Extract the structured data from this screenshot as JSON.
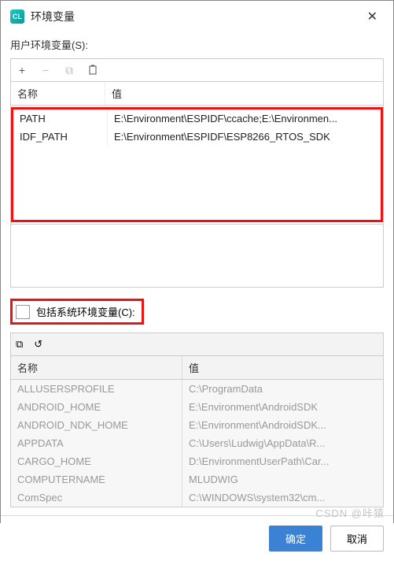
{
  "titlebar": {
    "title": "环境变量"
  },
  "userSection": {
    "label": "用户环境变量(S):",
    "toolbar": {
      "add": "+",
      "remove": "−",
      "copy": "⧉",
      "paste": "📋"
    },
    "headers": {
      "name": "名称",
      "value": "值"
    },
    "rows": [
      {
        "name": "PATH",
        "value": "E:\\Environment\\ESPIDF\\ccache;E:\\Environmen..."
      },
      {
        "name": "IDF_PATH",
        "value": "E:\\Environment\\ESPIDF\\ESP8266_RTOS_SDK"
      }
    ]
  },
  "includeSystem": {
    "label": "包括系统环境变量(C):",
    "checked": false
  },
  "systemSection": {
    "toolbar": {
      "copy": "⧉",
      "undo": "↺"
    },
    "headers": {
      "name": "名称",
      "value": "值"
    },
    "rows": [
      {
        "name": "ALLUSERSPROFILE",
        "value": "C:\\ProgramData"
      },
      {
        "name": "ANDROID_HOME",
        "value": "E:\\Environment\\AndroidSDK"
      },
      {
        "name": "ANDROID_NDK_HOME",
        "value": "E:\\Environment\\AndroidSDK..."
      },
      {
        "name": "APPDATA",
        "value": "C:\\Users\\Ludwig\\AppData\\R..."
      },
      {
        "name": "CARGO_HOME",
        "value": "D:\\EnvironmentUserPath\\Car..."
      },
      {
        "name": "COMPUTERNAME",
        "value": "MLUDWIG"
      },
      {
        "name": "ComSpec",
        "value": "C:\\WINDOWS\\system32\\cm..."
      }
    ]
  },
  "buttons": {
    "ok": "确定",
    "cancel": "取消"
  },
  "watermark": "CSDN @咔猿"
}
